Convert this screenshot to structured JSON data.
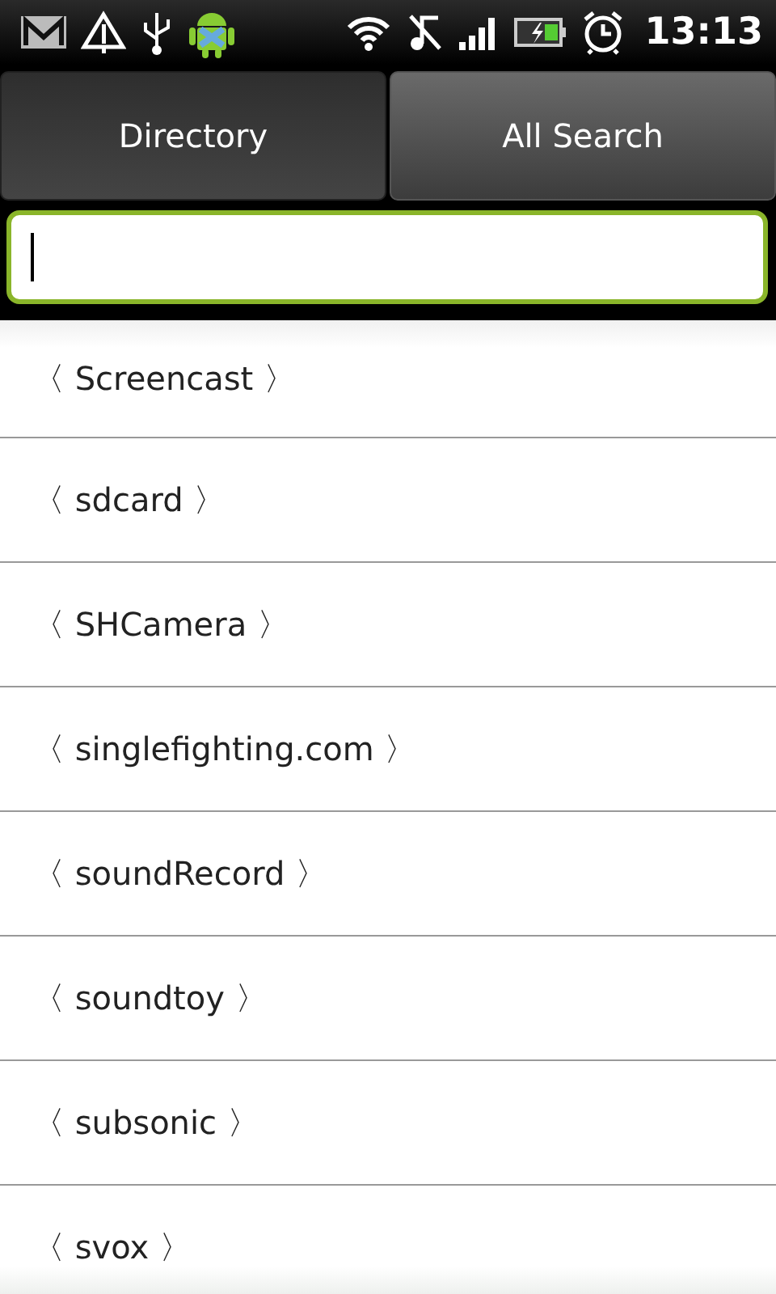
{
  "status_bar": {
    "time": "13:13"
  },
  "tabs": [
    {
      "label": "Directory",
      "selected": true
    },
    {
      "label": "All Search",
      "selected": false
    }
  ],
  "search": {
    "focused": true
  },
  "list": [
    {
      "label": "〈 Screencast 〉"
    },
    {
      "label": "〈 sdcard 〉"
    },
    {
      "label": "〈 SHCamera 〉"
    },
    {
      "label": "〈 singlefighting.com 〉"
    },
    {
      "label": "〈 soundRecord 〉"
    },
    {
      "label": "〈 soundtoy 〉"
    },
    {
      "label": "〈 subsonic 〉"
    },
    {
      "label": "〈 svox 〉"
    }
  ]
}
